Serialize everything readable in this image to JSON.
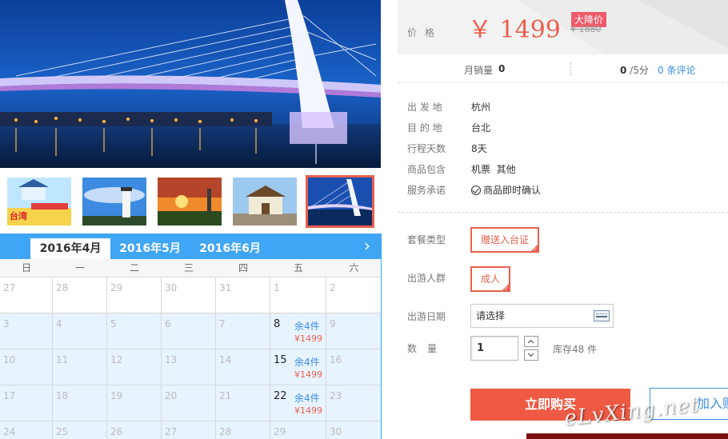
{
  "gallery": {
    "hero_icon": "harbor-bridge-night-photo",
    "thumbnails": [
      {
        "icon": "taiwan-promo-thumbnail",
        "promo_title": "台湾",
        "selected": false
      },
      {
        "icon": "lighthouse-thumbnail",
        "selected": false
      },
      {
        "icon": "sunset-tower-thumbnail",
        "selected": false
      },
      {
        "icon": "palace-thumbnail",
        "selected": false
      },
      {
        "icon": "bridge-thumbnail",
        "selected": true
      }
    ]
  },
  "calendar": {
    "months": [
      "2016年4月",
      "2016年5月",
      "2016年6月"
    ],
    "active_month": 0,
    "next_icon": "chevron-right-icon",
    "weekdays": [
      "日",
      "一",
      "二",
      "三",
      "四",
      "五",
      "六"
    ],
    "rows": [
      [
        {
          "d": "27"
        },
        {
          "d": "28"
        },
        {
          "d": "29"
        },
        {
          "d": "30"
        },
        {
          "d": "31"
        },
        {
          "d": "1"
        },
        {
          "d": "2"
        }
      ],
      [
        {
          "d": "3"
        },
        {
          "d": "4"
        },
        {
          "d": "5"
        },
        {
          "d": "6"
        },
        {
          "d": "7"
        },
        {
          "d": "8",
          "stock": "余4件",
          "price": "¥1499"
        },
        {
          "d": "9"
        }
      ],
      [
        {
          "d": "10"
        },
        {
          "d": "11"
        },
        {
          "d": "12"
        },
        {
          "d": "13"
        },
        {
          "d": "14"
        },
        {
          "d": "15",
          "stock": "余4件",
          "price": "¥1499"
        },
        {
          "d": "16"
        }
      ],
      [
        {
          "d": "17"
        },
        {
          "d": "18"
        },
        {
          "d": "19"
        },
        {
          "d": "20"
        },
        {
          "d": "21"
        },
        {
          "d": "22",
          "stock": "余4件",
          "price": "¥1499"
        },
        {
          "d": "23"
        }
      ],
      [
        {
          "d": "24"
        },
        {
          "d": "25"
        },
        {
          "d": "26"
        },
        {
          "d": "27"
        },
        {
          "d": "28"
        },
        {
          "d": "29"
        },
        {
          "d": "30"
        }
      ]
    ]
  },
  "price": {
    "label": "价格",
    "value": "￥ 1499",
    "badge": "大降价",
    "original": "¥ 1880"
  },
  "sales": {
    "label": "月销量",
    "count": "0",
    "score": "0",
    "score_suffix": " /5分",
    "reviews": "0 条评论"
  },
  "details": [
    {
      "label": "出 发 地",
      "value": "杭州"
    },
    {
      "label": "目 的 地",
      "value": "台北"
    },
    {
      "label": "行程天数",
      "value": "8天"
    },
    {
      "label": "商品包含",
      "value": "机票  其他"
    },
    {
      "label": "服务承诺",
      "value": "商品即时确认",
      "icon": "check-circle-icon"
    }
  ],
  "options": {
    "package_label": "套餐类型",
    "package_value": "赠送入台证",
    "crowd_label": "出游人群",
    "crowd_value": "成人",
    "date_label": "出游日期",
    "date_placeholder": "请选择",
    "date_icon": "calendar-icon",
    "qty_label": "数量",
    "qty_value": "1",
    "stock_text": "库存48 件"
  },
  "actions": {
    "buy": "立即购买",
    "cart": "加入购物车"
  },
  "watermark": "eLvXing.net",
  "colors": {
    "accent": "#e8604c",
    "link": "#3b8ee6",
    "calendar_header": "#3fa5f5",
    "calendar_available": "#e7f3ff"
  }
}
